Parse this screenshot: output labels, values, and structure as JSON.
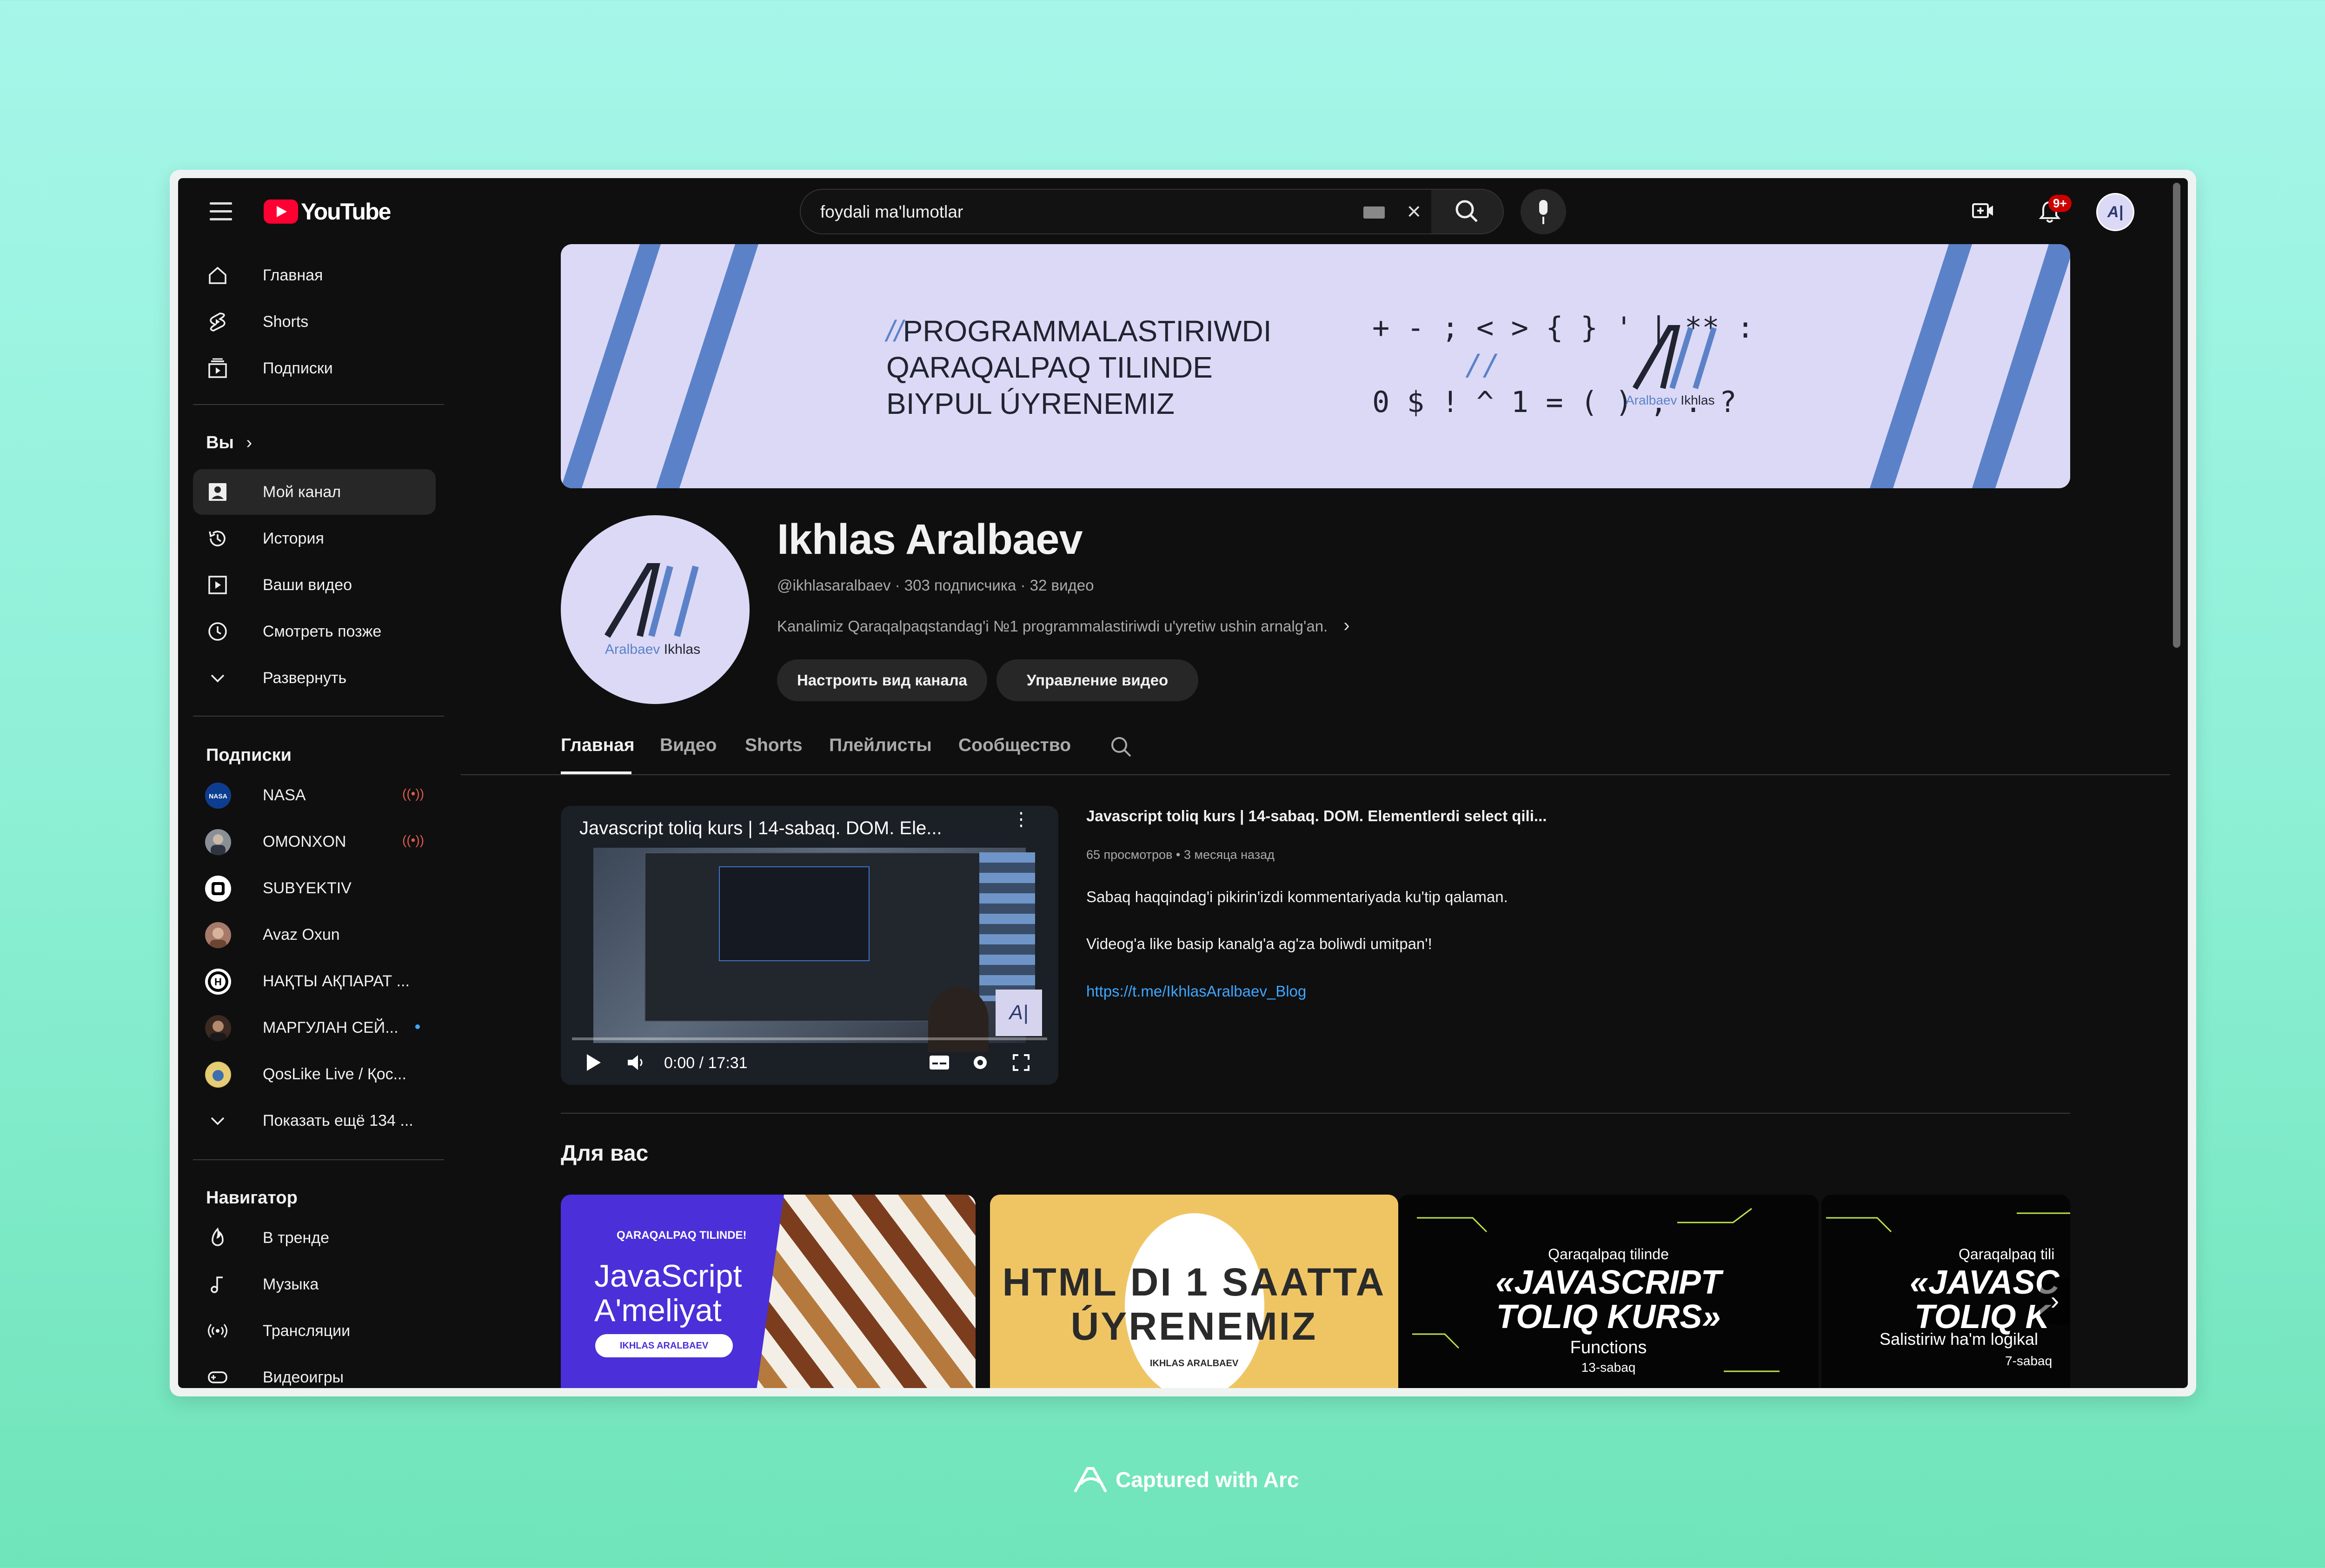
{
  "header": {
    "logo_text": "YouTube",
    "search_value": "foydali ma'lumotlar",
    "notifications_badge": "9+",
    "avatar_initials": "A|"
  },
  "sidebar": {
    "main": [
      {
        "label": "Главная",
        "icon": "home-icon"
      },
      {
        "label": "Shorts",
        "icon": "shorts-icon"
      },
      {
        "label": "Подписки",
        "icon": "subscriptions-icon"
      }
    ],
    "you_heading": "Вы",
    "you_items": [
      {
        "label": "Мой канал",
        "icon": "my-channel-icon"
      },
      {
        "label": "История",
        "icon": "history-icon"
      },
      {
        "label": "Ваши видео",
        "icon": "your-videos-icon"
      },
      {
        "label": "Смотреть позже",
        "icon": "watch-later-icon"
      },
      {
        "label": "Развернуть",
        "icon": "chevron-down-icon"
      }
    ],
    "subs_heading": "Подписки",
    "subscriptions": [
      {
        "name": "NASA",
        "status": "live"
      },
      {
        "name": "OMONXON",
        "status": "live"
      },
      {
        "name": "SUBYEKTIV",
        "status": ""
      },
      {
        "name": "Avaz Oxun",
        "status": ""
      },
      {
        "name": "НАҚТЫ АҚПАРАТ ...",
        "status": ""
      },
      {
        "name": "МАРГУЛАН СЕЙ...",
        "status": "new"
      },
      {
        "name": "QosLike Live / Қос...",
        "status": ""
      }
    ],
    "show_more": "Показать ещё 134 ...",
    "nav_heading": "Навигатор",
    "nav_items": [
      {
        "label": "В тренде",
        "icon": "trending-icon"
      },
      {
        "label": "Музыка",
        "icon": "music-icon"
      },
      {
        "label": "Трансляции",
        "icon": "live-icon"
      },
      {
        "label": "Видеоигры",
        "icon": "gaming-icon"
      }
    ]
  },
  "banner": {
    "line1_prefix": "//",
    "line1": "PROGRAMMALASTIRIWDI",
    "line2": "QARAQALPAQ TILINDE",
    "line3": "BIYPUL ÚYRENEMIZ",
    "symbols1": "+ - ; < > { } ' | ** :",
    "symbols2": "//",
    "symbols3": "0 $ ! ^ 1 = ( ) , . ?",
    "logo_sub1": "Aralbaev",
    "logo_sub2": "Ikhlas"
  },
  "channel": {
    "name": "Ikhlas Aralbaev",
    "meta": "@ikhlasaralbaev · 303 подписчика · 32 видео",
    "description": "Kanalimiz Qaraqalpaqstandag'i №1 programmalastiriwdi u'yretiw ushin arnalg'an.",
    "customize_button": "Настроить вид канала",
    "manage_button": "Управление видео",
    "avatar_sub1": "Aralbaev",
    "avatar_sub2": "Ikhlas"
  },
  "tabs": [
    "Главная",
    "Видео",
    "Shorts",
    "Плейлисты",
    "Сообщество"
  ],
  "featured": {
    "player_title": "Javascript toliq kurs | 14-sabaq. DOM. Ele...",
    "time": "0:00 / 17:31",
    "progress": 0.0,
    "title": "Javascript toliq kurs |  14-sabaq. DOM. Elementlerdi select qili...",
    "meta": "65 просмотров • 3 месяца назад",
    "desc1": "Sabaq haqqindag'i pikirin'izdi kommentariyada ku'tip qalaman.",
    "desc2": "Videog'a like basip kanalg'a ag'za boliwdi umitpan'!",
    "link": "https://t.me/IkhlasAralbaev_Blog"
  },
  "for_you": {
    "heading": "Для вас",
    "cards": [
      {
        "top": "QARAQALPAQ TILINDE!",
        "title1": "JavaScript",
        "title2": "A'meliyat",
        "tag": "IKHLAS ARALBAEV"
      },
      {
        "title1": "HTML DI 1 SAATTA",
        "title2": "ÚYRENEMIZ",
        "tag": "IKHLAS ARALBAEV"
      },
      {
        "top": "Qaraqalpaq tilinde",
        "title1": "«JAVASCRIPT",
        "title2": "TOLIQ KURS»",
        "sub": "Functions",
        "lesson": "13-sabaq"
      },
      {
        "top": "Qaraqalpaq tili",
        "title1": "«JAVASC",
        "title2": "TOLIQ K",
        "sub": "Salistiriw ha'm logikal",
        "lesson": "7-sabaq"
      }
    ]
  },
  "footer": {
    "captured": "Captured with Arc"
  },
  "colors": {
    "accent_red": "#ff0033",
    "link": "#3ea6ff",
    "banner_bg": "#dcd9f6",
    "stripe": "#5b82c8"
  }
}
